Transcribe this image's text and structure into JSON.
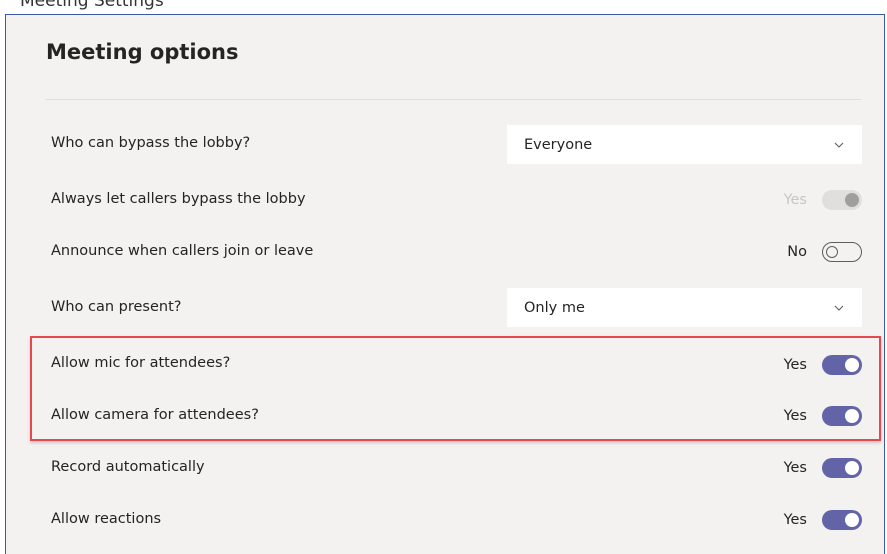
{
  "caption": "Meeting Settings",
  "title": "Meeting options",
  "rows": [
    {
      "label": "Who can bypass the lobby?",
      "type": "dropdown",
      "value": "Everyone"
    },
    {
      "label": "Always let callers bypass the lobby",
      "type": "toggle",
      "state_text": "Yes",
      "on": true,
      "disabled": true
    },
    {
      "label": "Announce when callers join or leave",
      "type": "toggle",
      "state_text": "No",
      "on": false,
      "disabled": false
    },
    {
      "label": "Who can present?",
      "type": "dropdown",
      "value": "Only me"
    },
    {
      "label": "Allow mic for attendees?",
      "type": "toggle",
      "state_text": "Yes",
      "on": true,
      "disabled": false
    },
    {
      "label": "Allow camera for attendees?",
      "type": "toggle",
      "state_text": "Yes",
      "on": true,
      "disabled": false
    },
    {
      "label": "Record automatically",
      "type": "toggle",
      "state_text": "Yes",
      "on": true,
      "disabled": false
    },
    {
      "label": "Allow reactions",
      "type": "toggle",
      "state_text": "Yes",
      "on": true,
      "disabled": false
    }
  ],
  "colors": {
    "accent": "#6264a7",
    "highlight": "#e8474f",
    "panel_bg": "#f3f2f1"
  }
}
